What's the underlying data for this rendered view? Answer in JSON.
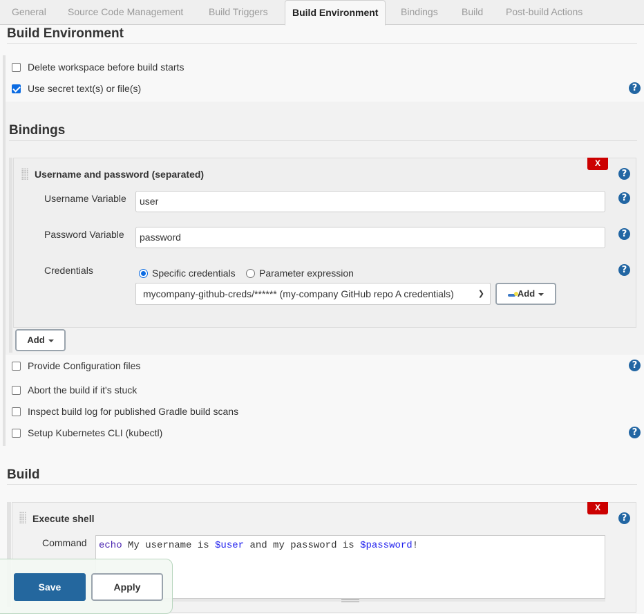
{
  "tabs": [
    {
      "label": "General",
      "active": false
    },
    {
      "label": "Source Code Management",
      "active": false
    },
    {
      "label": "Build Triggers",
      "active": false
    },
    {
      "label": "Build Environment",
      "active": true
    },
    {
      "label": "Bindings",
      "active": false
    },
    {
      "label": "Build",
      "active": false
    },
    {
      "label": "Post-build Actions",
      "active": false
    }
  ],
  "build_environment": {
    "title": "Build Environment",
    "options_top": [
      {
        "label": "Delete workspace before build starts",
        "checked": false
      },
      {
        "label": "Use secret text(s) or file(s)",
        "checked": true
      }
    ],
    "bindings": {
      "title": "Bindings",
      "binding": {
        "title": "Username and password (separated)",
        "delete_label": "X",
        "username_label": "Username Variable",
        "username_value": "user",
        "password_label": "Password Variable",
        "password_value": "password",
        "credentials_label": "Credentials",
        "radio_specific": "Specific credentials",
        "radio_specific_checked": true,
        "radio_parameter": "Parameter expression",
        "radio_parameter_checked": false,
        "credentials_selected": "mycompany-github-creds/****** (my-company GitHub repo A credentials)",
        "add_credentials_label": "Add"
      },
      "add_label": "Add"
    },
    "options_bottom": [
      {
        "label": "Provide Configuration files",
        "checked": false
      },
      {
        "label": "Abort the build if it's stuck",
        "checked": false
      },
      {
        "label": "Inspect build log for published Gradle build scans",
        "checked": false
      },
      {
        "label": "Setup Kubernetes CLI (kubectl)",
        "checked": false
      }
    ]
  },
  "build": {
    "title": "Build",
    "step": {
      "title": "Execute shell",
      "delete_label": "X",
      "command_label": "Command",
      "command_tokens": [
        {
          "text": "echo",
          "kind": "kw"
        },
        {
          "text": " My username is ",
          "kind": "plain"
        },
        {
          "text": "$user",
          "kind": "var"
        },
        {
          "text": " and my password is ",
          "kind": "plain"
        },
        {
          "text": "$password",
          "kind": "var"
        },
        {
          "text": "!",
          "kind": "plain"
        }
      ]
    }
  },
  "actions": {
    "save": "Save",
    "apply": "Apply"
  },
  "help_glyph": "?",
  "colors": {
    "primary": "#24679e",
    "danger": "#cc0000",
    "help": "#2266a3",
    "checkbox": "#0b6be2"
  }
}
